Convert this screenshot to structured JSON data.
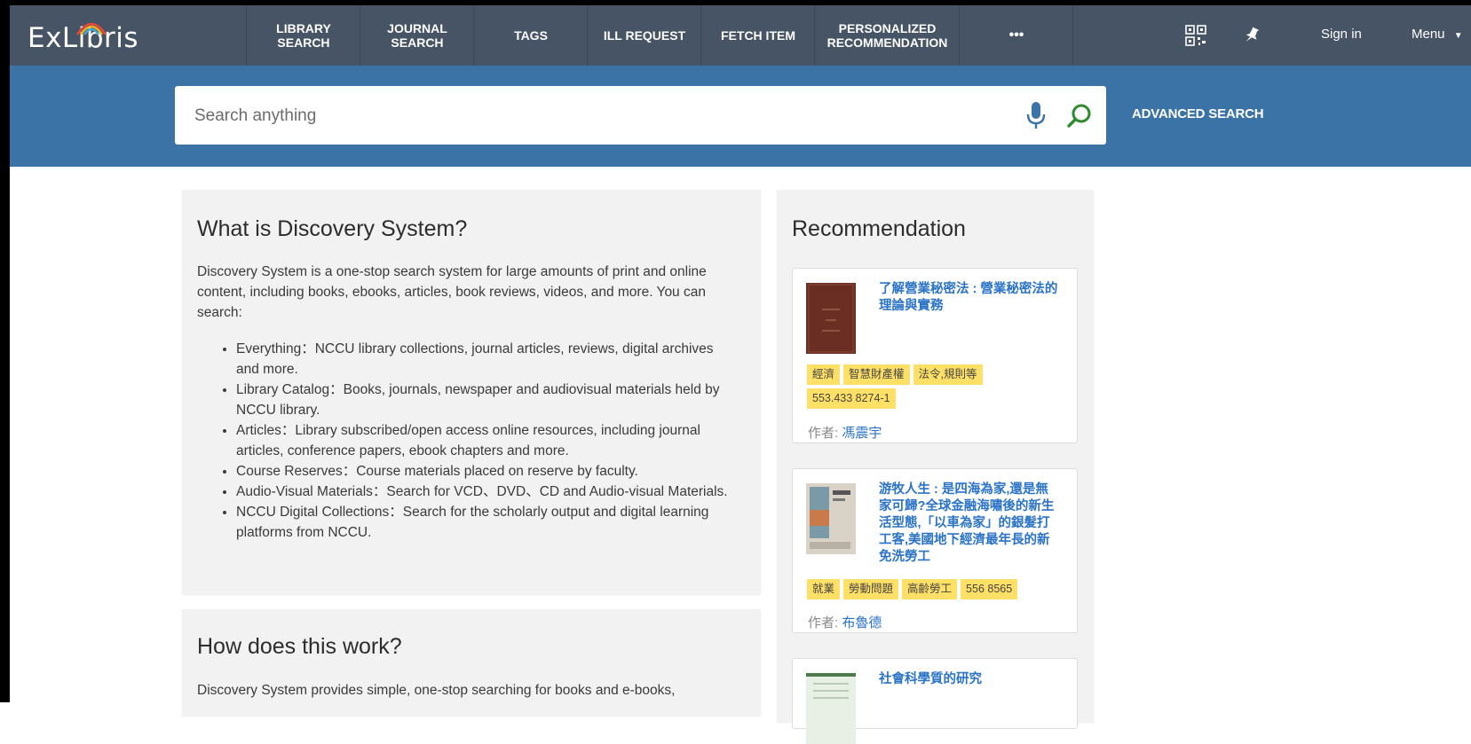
{
  "app": {
    "logo_text": "ExLibris",
    "nav": [
      {
        "line1": "LIBRARY",
        "line2": "SEARCH"
      },
      {
        "line1": "JOURNAL",
        "line2": "SEARCH"
      },
      {
        "line1": "TAGS",
        "line2": ""
      },
      {
        "line1": "ILL REQUEST",
        "line2": ""
      },
      {
        "line1": "FETCH ITEM",
        "line2": ""
      },
      {
        "line1": "PERSONALIZED",
        "line2": "RECOMMENDATION"
      },
      {
        "line1": "•••",
        "line2": ""
      }
    ],
    "signin_label": "Sign in",
    "menu_label": "Menu",
    "icons": [
      "qr-code-icon",
      "pin-icon",
      "microphone-icon",
      "search-icon",
      "chevron-down-icon"
    ]
  },
  "search": {
    "placeholder": "Search anything",
    "value": "",
    "advanced_label": "ADVANCED SEARCH"
  },
  "about": {
    "title": "What is Discovery System?",
    "intro": "Discovery System is a one-stop search system for large amounts of print and online content, including books, ebooks, articles, book reviews, videos, and more. You can search:",
    "items": [
      "Everything：NCCU library collections, journal articles, reviews, digital archives and more.",
      "Library Catalog：Books, journals, newspaper and audiovisual materials held by NCCU library.",
      "Articles：Library subscribed/open access online resources, including journal articles, conference papers, ebook chapters and more.",
      "Course Reserves：Course materials placed on reserve by faculty.",
      "Audio-Visual Materials：Search for VCD、DVD、CD and Audio-visual Materials.",
      "NCCU Digital Collections：Search for the scholarly output and digital learning platforms from NCCU."
    ]
  },
  "how": {
    "title": "How does this work?",
    "intro": "Discovery System provides simple, one-stop searching for books and e-books,"
  },
  "recommendation": {
    "title": "Recommendation",
    "author_prefix": "作者: ",
    "cards": [
      {
        "title": "了解營業秘密法 : 營業秘密法的理論與實務",
        "tags": [
          "經濟",
          "智慧財產權",
          "法令,規則等",
          "553.433 8274-1"
        ],
        "author": "馮震宇",
        "cover_color": "#6b2e22"
      },
      {
        "title": "游牧人生 : 是四海為家,還是無家可歸?全球金融海嘯後的新生活型態,「以車為家」的銀髮打工客,美國地下經濟最年長的新免洗勞工",
        "tags": [
          "就業",
          "勞動問題",
          "高齡勞工",
          "556 8565"
        ],
        "author": "布魯德",
        "cover_color": "#d9d2c6"
      },
      {
        "title": "社會科學質的研究",
        "tags": [],
        "author": "",
        "cover_color": "#e8efe4"
      }
    ]
  }
}
